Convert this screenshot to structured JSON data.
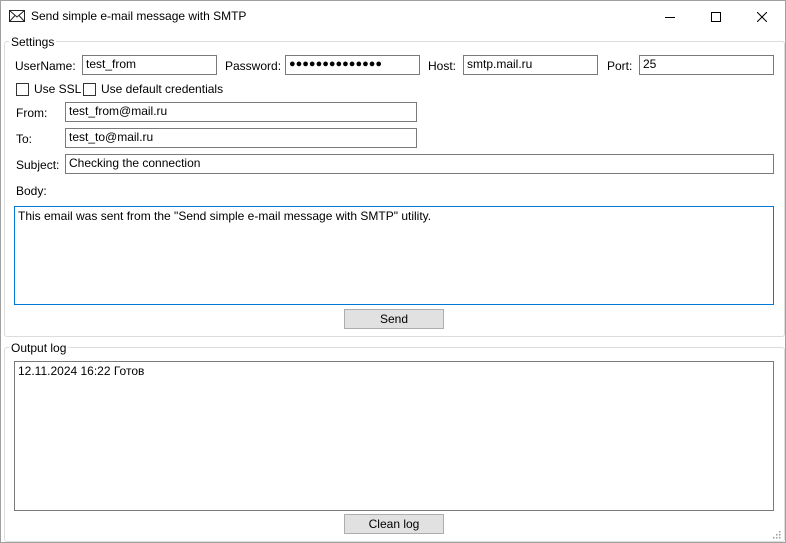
{
  "window": {
    "title": "Send simple e-mail message with SMTP",
    "icon": "envelope-icon"
  },
  "settings": {
    "group_title": "Settings",
    "username_label": "UserName:",
    "username_value": "test_from",
    "password_label": "Password:",
    "password_value": "●●●●●●●●●●●●●●",
    "host_label": "Host:",
    "host_value": "smtp.mail.ru",
    "port_label": "Port:",
    "port_value": "25",
    "use_ssl_label": "Use SSL",
    "use_ssl_checked": false,
    "use_default_credentials_label": "Use default credentials",
    "use_default_credentials_checked": false,
    "from_label": "From:",
    "from_value": "test_from@mail.ru",
    "to_label": "To:",
    "to_value": "test_to@mail.ru",
    "subject_label": "Subject:",
    "subject_value": "Checking the connection",
    "body_label": "Body:",
    "body_value": "This email was sent from the \"Send simple e-mail message with SMTP\" utility.",
    "send_label": "Send"
  },
  "output_log": {
    "group_title": "Output log",
    "log_text": "12.11.2024 16:22 Готов",
    "clean_label": "Clean log"
  },
  "colors": {
    "focus_border": "#0078d7",
    "button_bg": "#e1e1e1",
    "button_border": "#adadad"
  }
}
